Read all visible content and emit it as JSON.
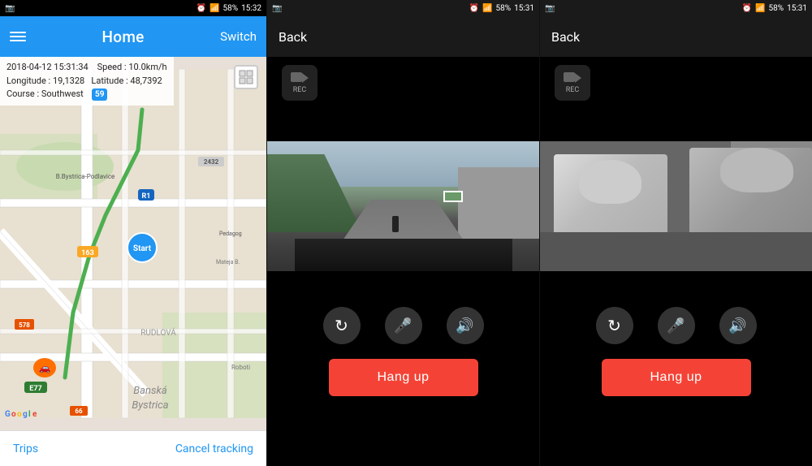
{
  "panel_map": {
    "status_bar": {
      "camera_icon": "📷",
      "time": "15:32",
      "battery": "58%",
      "wifi": "wifi",
      "signal": "signal"
    },
    "header": {
      "title": "Home",
      "switch_label": "Switch"
    },
    "info": {
      "datetime": "2018-04-12  15:31:34",
      "speed_label": "Speed :",
      "speed_value": "10.0km/h",
      "longitude_label": "Longitude :",
      "longitude_value": "19,1328",
      "latitude_label": "Latitude :",
      "latitude_value": "48,7392",
      "course_label": "Course :",
      "course_value": "Southwest",
      "badge": "59"
    },
    "footer": {
      "trips_label": "Trips",
      "cancel_label": "Cancel tracking"
    }
  },
  "panel_front": {
    "status_bar": {
      "time": "15:31",
      "battery": "58%"
    },
    "header": {
      "back_label": "Back"
    },
    "rec_label": "REC",
    "controls": {
      "refresh_icon": "↻",
      "mute_icon": "🎤",
      "speaker_icon": "🔊"
    },
    "hangup_label": "Hang up"
  },
  "panel_interior": {
    "status_bar": {
      "time": "15:31",
      "battery": "58%"
    },
    "header": {
      "back_label": "Back"
    },
    "rec_label": "REC",
    "controls": {
      "refresh_icon": "↻",
      "mute_icon": "🎤",
      "speaker_icon": "🔊"
    },
    "hangup_label": "Hang up"
  }
}
